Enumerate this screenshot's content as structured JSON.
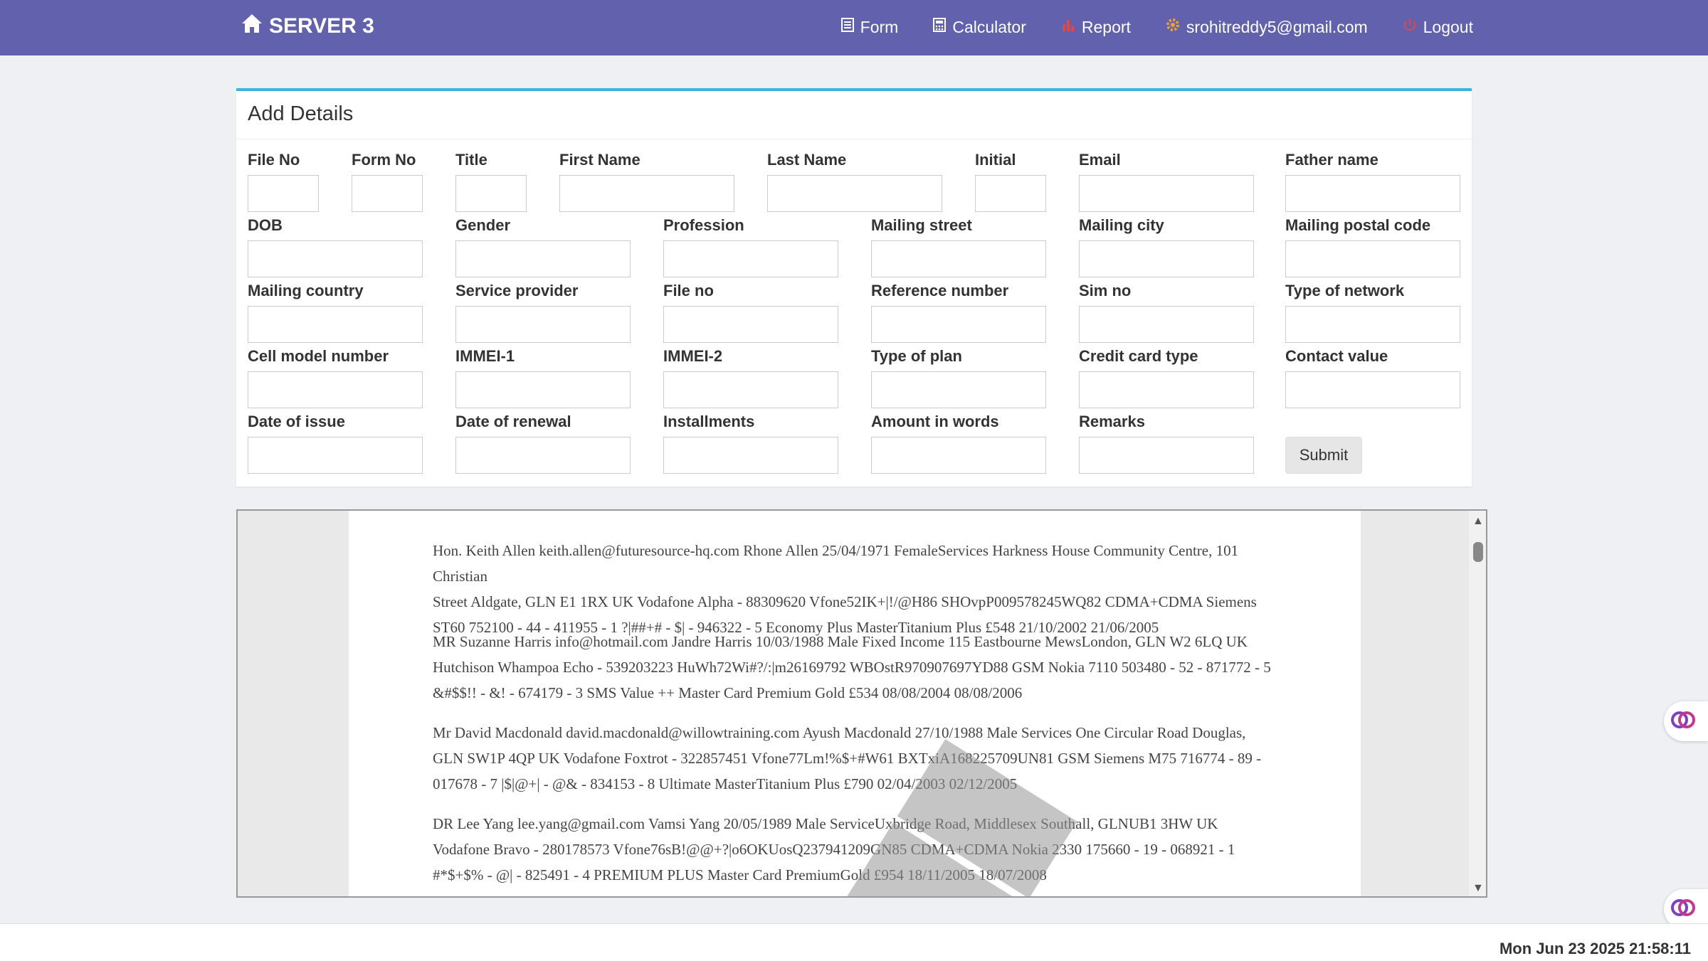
{
  "navbar": {
    "brand": "SERVER 3",
    "items": [
      {
        "label": "Form",
        "icon": "form-icon"
      },
      {
        "label": "Calculator",
        "icon": "calculator-icon"
      },
      {
        "label": "Report",
        "icon": "bar-chart-icon"
      },
      {
        "label": "srohitreddy5@gmail.com",
        "icon": "gear-icon"
      },
      {
        "label": "Logout",
        "icon": "power-icon"
      }
    ],
    "accent_color": "#6161ad"
  },
  "form": {
    "title": "Add Details",
    "fields": [
      {
        "label": "File No",
        "value": ""
      },
      {
        "label": "Form No",
        "value": ""
      },
      {
        "label": "Title",
        "value": ""
      },
      {
        "label": "First Name",
        "value": ""
      },
      {
        "label": "Last Name",
        "value": ""
      },
      {
        "label": "Initial",
        "value": ""
      },
      {
        "label": "Email",
        "value": ""
      },
      {
        "label": "Father name",
        "value": ""
      },
      {
        "label": "DOB",
        "value": ""
      },
      {
        "label": "Gender",
        "value": ""
      },
      {
        "label": "Profession",
        "value": ""
      },
      {
        "label": "Mailing street",
        "value": ""
      },
      {
        "label": "Mailing city",
        "value": ""
      },
      {
        "label": "Mailing postal code",
        "value": ""
      },
      {
        "label": "Mailing country",
        "value": ""
      },
      {
        "label": "Service provider",
        "value": ""
      },
      {
        "label": "File no",
        "value": ""
      },
      {
        "label": "Reference number",
        "value": ""
      },
      {
        "label": "Sim no",
        "value": ""
      },
      {
        "label": "Type of network",
        "value": ""
      },
      {
        "label": "Cell model number",
        "value": ""
      },
      {
        "label": "IMMEI-1",
        "value": ""
      },
      {
        "label": "IMMEI-2",
        "value": ""
      },
      {
        "label": "Type of plan",
        "value": ""
      },
      {
        "label": "Credit card type",
        "value": ""
      },
      {
        "label": "Contact value",
        "value": ""
      },
      {
        "label": "Date of issue",
        "value": ""
      },
      {
        "label": "Date of renewal",
        "value": ""
      },
      {
        "label": "Installments",
        "value": ""
      },
      {
        "label": "Amount in words",
        "value": ""
      },
      {
        "label": "Remarks",
        "value": ""
      }
    ],
    "submit_label": "Submit"
  },
  "document": {
    "records": [
      {
        "lines": [
          "Hon.   Keith   Allen   keith.allen@futuresource-hq.com   Rhone Allen   25/04/1971   FemaleServices   Harkness House Community Centre, 101 Christian",
          "Street  Aldgate, GLN E1 1RX   UK   Vodafone   Alpha - 88309620   Vfone52IK+|!/@H86  SHOvpP009578245WQ82   CDMA+CDMA   Siemens",
          "ST60   752100 - 44 - 411955 - 1   ?|##+# - $| - 946322 - 5   Economy Plus MasterTitanium Plus  £548   21/10/2002   21/06/2005"
        ]
      },
      {
        "lines": [
          "MR   Suzanne   Harris  info@hotmail.com   Jandre Harris  10/03/1988   Male   Fixed Income  115 Eastbourne MewsLondon, GLN W2 6LQ   UK",
          "        Hutchison Whampoa  Echo - 539203223   HuWh72Wi#?/:|m26169792  WBOstR970907697YD88   GSM  Nokia 7110   503480 - 52 - 871772 - 5",
          "        &#$$!! - &! - 674179 - 3   SMS Value ++   Master Card Premium Gold  £534   08/08/2004   08/08/2006"
        ]
      },
      {
        "lines": [
          "Mr   David  Macdonald   david.macdonald@willowtraining.com   Ayush Macdonald   27/10/1988   Male   Services   One Circular Road   Douglas,",
          "GLN  SW1P 4QP  UK  Vodafone   Foxtrot - 322857451  Vfone77Lm!%$+#W61   BXTxiA168225709UN81  GSM  Siemens M75  716774 - 89 -",
          "017678 - 7   |$|@+| - @& - 834153 - 8   Ultimate   MasterTitanium Plus  £790   02/04/2003   02/12/2005"
        ]
      },
      {
        "lines": [
          "DR   Lee   Yang  lee.yang@gmail.com  Vamsi Yang   20/05/1989   Male   ServiceUxbridge Road, Middlesex   Southall, GLNUB1 3HW   UK",
          "        Vodafone   Bravo - 280178573   Vfone76sB!@@+?|o6OKUosQ237941209GN85   CDMA+CDMA   Nokia 2330   175660 - 19 - 068921 - 1",
          "        #*$+$% - @| - 825491 - 4   PREMIUM PLUS   Master Card PremiumGold  £954   18/11/2005   18/07/2008"
        ]
      }
    ]
  },
  "footer": {
    "timestamp": "Mon Jun 23 2025 21:58:11"
  }
}
